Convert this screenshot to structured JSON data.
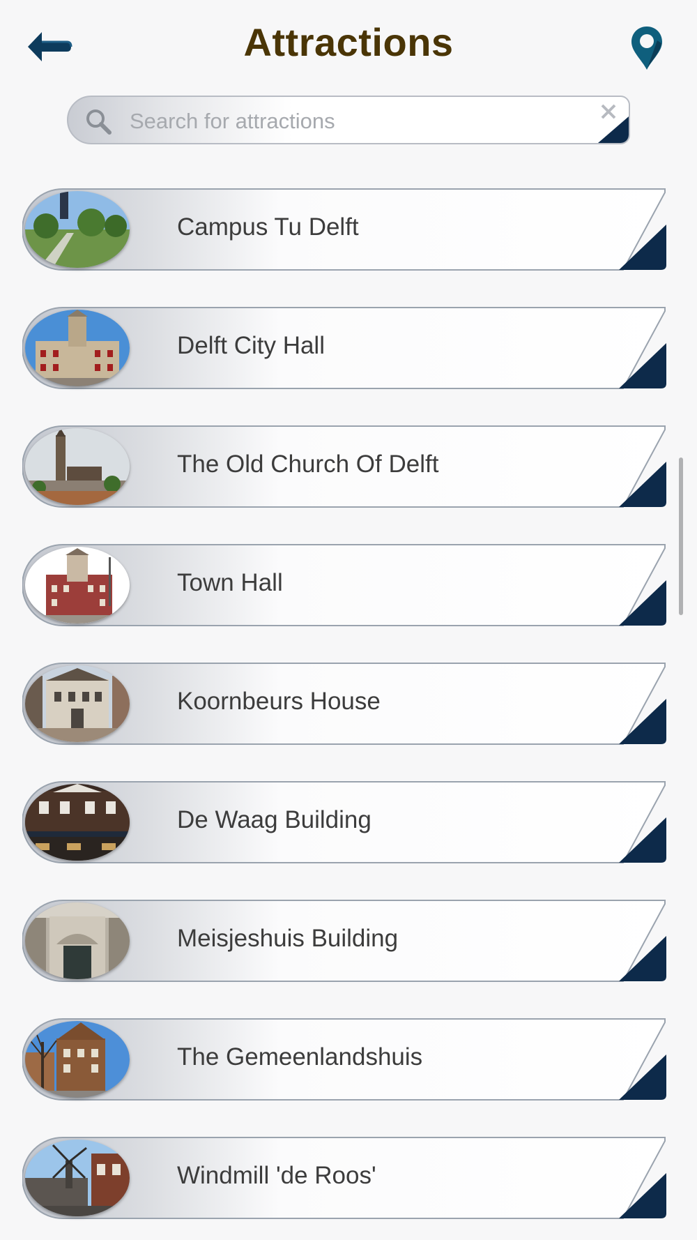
{
  "header": {
    "title": "Attractions",
    "back_icon": "back-arrow-icon",
    "location_icon": "map-pin-icon"
  },
  "search": {
    "placeholder": "Search for attractions",
    "value": ""
  },
  "colors": {
    "brand_navy": "#0d2a4a",
    "title_brown": "#4a3506",
    "pin_teal": "#0f5f7d"
  },
  "attractions": [
    {
      "name": "Campus Tu Delft"
    },
    {
      "name": "Delft City Hall"
    },
    {
      "name": "The Old Church Of Delft"
    },
    {
      "name": "Town Hall"
    },
    {
      "name": "Koornbeurs House"
    },
    {
      "name": "De Waag Building"
    },
    {
      "name": "Meisjeshuis Building"
    },
    {
      "name": "The Gemeenlandshuis"
    },
    {
      "name": "Windmill 'de Roos'"
    }
  ]
}
